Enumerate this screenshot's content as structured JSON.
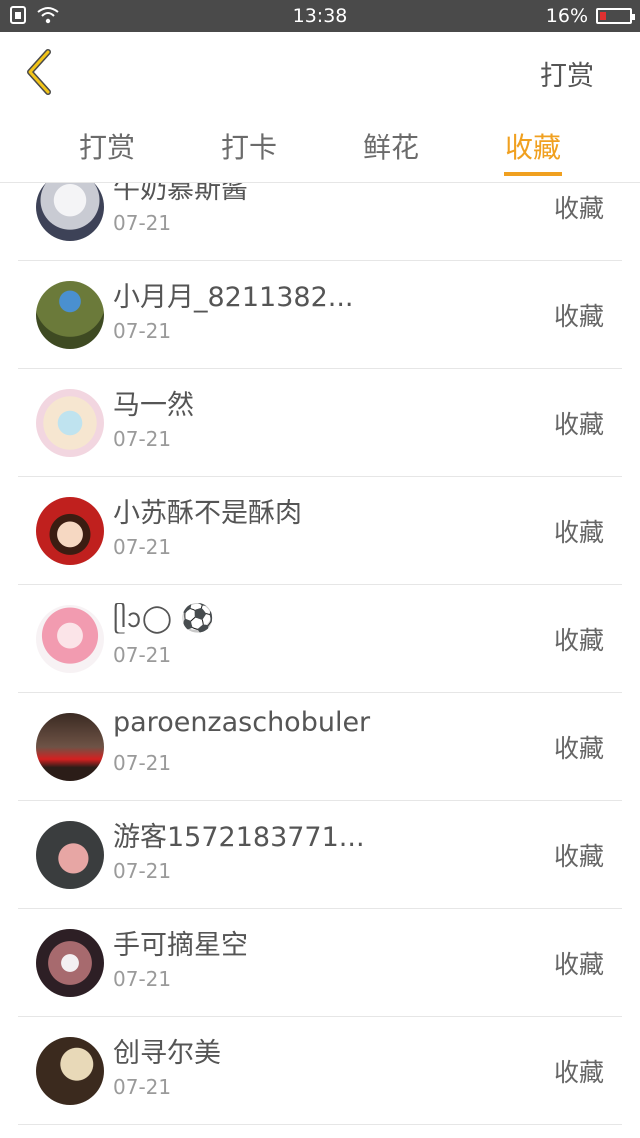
{
  "status_bar": {
    "time": "13:38",
    "battery": "16%",
    "icons": [
      "sim-icon",
      "wifi-icon",
      "battery-icon"
    ],
    "battery_level": 0.16,
    "battery_color": "#e03030"
  },
  "header": {
    "back_icon": "chevron-left-icon",
    "action_label": "打赏",
    "accent_color": "#f0a020"
  },
  "tabs": [
    {
      "label": "打赏",
      "active": false
    },
    {
      "label": "打卡",
      "active": false
    },
    {
      "label": "鲜花",
      "active": false
    },
    {
      "label": "收藏",
      "active": true
    }
  ],
  "list": [
    {
      "name": "牛奶慕斯酱",
      "date": "07-21",
      "action": "收藏"
    },
    {
      "name": "小月月_8211382...",
      "date": "07-21",
      "action": "收藏"
    },
    {
      "name": "马一然",
      "date": "07-21",
      "action": "收藏"
    },
    {
      "name": "小苏酥不是酥肉",
      "date": "07-21",
      "action": "收藏"
    },
    {
      "name": "ᥫᩣ◯ ⚽",
      "date": "07-21",
      "action": "收藏"
    },
    {
      "name": "paroenzaschobuler",
      "date": "07-21",
      "action": "收藏"
    },
    {
      "name": "游客1572183771...",
      "date": "07-21",
      "action": "收藏"
    },
    {
      "name": "手可摘星空",
      "date": "07-21",
      "action": "收藏"
    },
    {
      "name": "创寻尔美",
      "date": "07-21",
      "action": "收藏"
    }
  ]
}
